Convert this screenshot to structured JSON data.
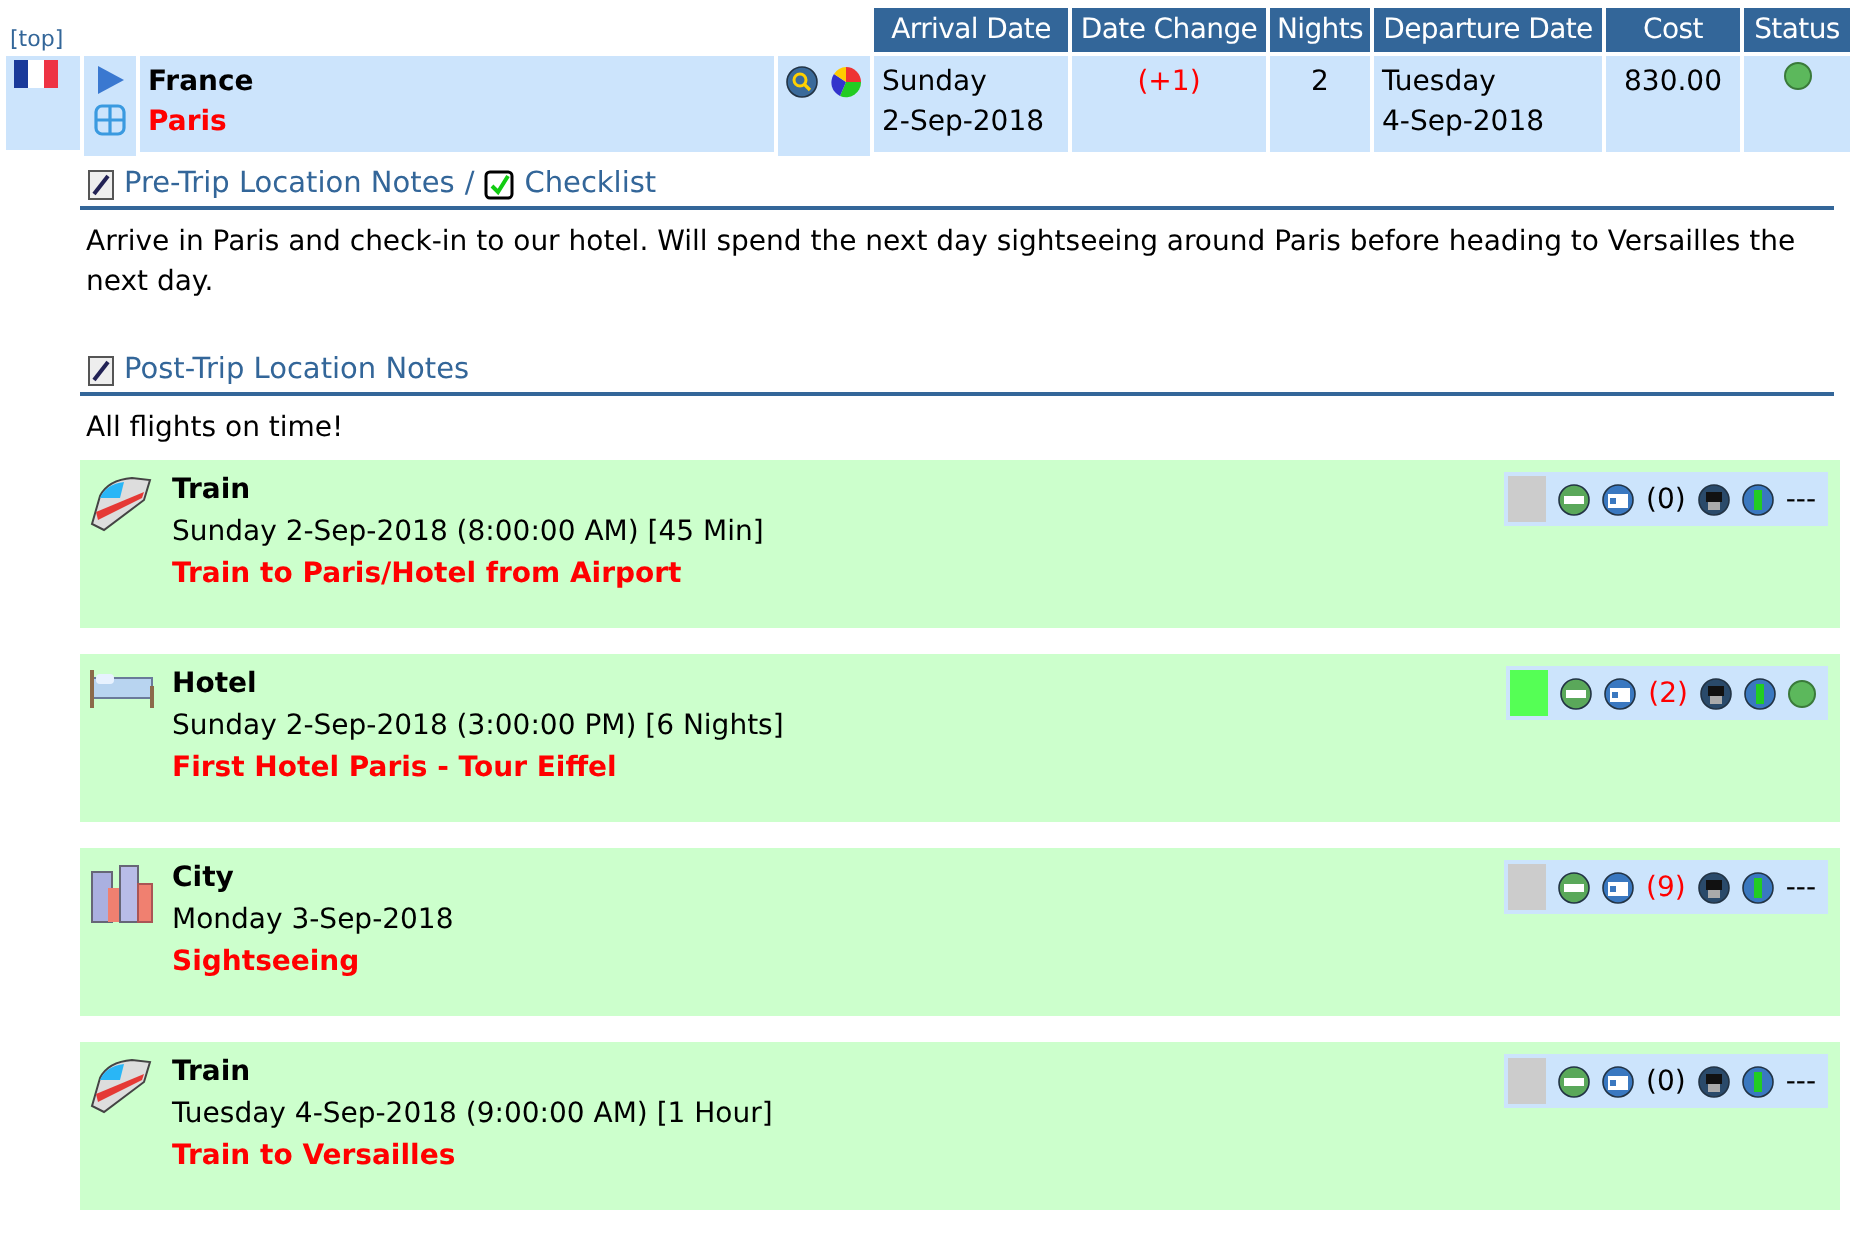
{
  "top_link": "[top]",
  "columns": [
    "Arrival Date",
    "Date Change",
    "Nights",
    "Departure Date",
    "Cost",
    "Status"
  ],
  "location": {
    "country": "France",
    "city": "Paris",
    "arrival_day": "Sunday",
    "arrival_date": "2-Sep-2018",
    "date_change": "(+1)",
    "nights": "2",
    "departure_day": "Tuesday",
    "departure_date": "4-Sep-2018",
    "cost": "830.00",
    "status": {
      "color": "#5cb85c"
    }
  },
  "pre_notes": {
    "title": "Pre-Trip Location Notes",
    "separator": "/",
    "checklist": "Checklist",
    "text": "Arrive in Paris and check-in to our hotel. Will spend the next day sightseeing around Paris before heading to Versailles the next day."
  },
  "post_notes": {
    "title": "Post-Trip Location Notes",
    "text": "All flights on time!"
  },
  "items": [
    {
      "kind": "train",
      "title": "Train",
      "when": "Sunday 2-Sep-2018 (8:00:00 AM) [45 Min]",
      "name": "Train to Paris/Hotel from Airport",
      "color": "#cccccc",
      "count": "(0)",
      "count_alert": false,
      "status": {
        "kind": "text",
        "text": "---"
      }
    },
    {
      "kind": "hotel",
      "title": "Hotel",
      "when": "Sunday 2-Sep-2018 (3:00:00 PM) [6 Nights]",
      "name": "First Hotel Paris - Tour Eiffel",
      "color": "#55ff55",
      "count": "(2)",
      "count_alert": true,
      "status": {
        "kind": "dot",
        "color": "#5cb85c"
      }
    },
    {
      "kind": "city",
      "title": "City",
      "when": "Monday 3-Sep-2018",
      "name": "Sightseeing",
      "color": "#cccccc",
      "count": "(9)",
      "count_alert": true,
      "status": {
        "kind": "text",
        "text": "---"
      }
    },
    {
      "kind": "train",
      "title": "Train",
      "when": "Tuesday 4-Sep-2018 (9:00:00 AM) [1 Hour]",
      "name": "Train to Versailles",
      "color": "#cccccc",
      "count": "(0)",
      "count_alert": false,
      "status": {
        "kind": "text",
        "text": "---"
      }
    }
  ]
}
